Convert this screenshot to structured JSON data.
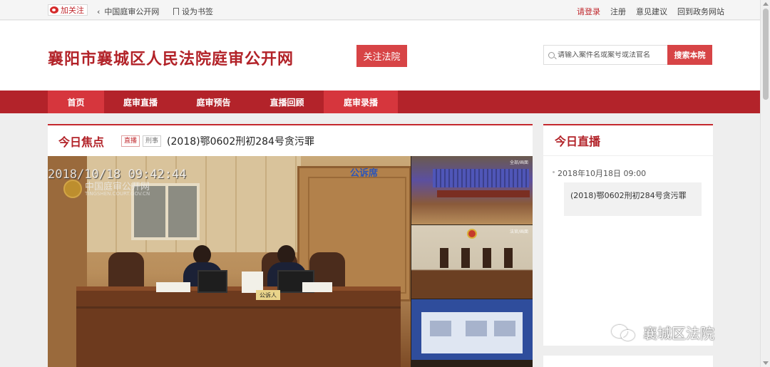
{
  "topbar": {
    "follow": "加关注",
    "back_link": "中国庭审公开网",
    "bookmark": "设为书签",
    "links": [
      "请登录",
      "注册",
      "意见建议",
      "回到政务网站"
    ]
  },
  "header": {
    "site_title": "襄阳市襄城区人民法院庭审公开网",
    "follow_button": "关注法院",
    "search_placeholder": "请输入案件名或案号或法官名",
    "search_button": "搜索本院"
  },
  "nav": {
    "items": [
      "首页",
      "庭审直播",
      "庭审预告",
      "直播回顾",
      "庭审录播"
    ],
    "active_index": 0
  },
  "focus": {
    "title": "今日焦点",
    "tags": [
      "直播",
      "刑事"
    ],
    "case_title": "(2018)鄂0602刑初284号贪污罪"
  },
  "video": {
    "timestamp": "2018/10/18 09:42:44",
    "watermark": "中国庭审公开网",
    "watermark_sub": "TINGSHEN.COURT.GOV.CN",
    "room_sign": "公诉席",
    "nameplate": "公诉人",
    "thumb_label_1": "全部/画面",
    "thumb_label_2": "法官/画面"
  },
  "live": {
    "title": "今日直播",
    "date": "2018年10月18日 09:00",
    "case": "(2018)鄂0602刑初284号贪污罪"
  },
  "overlay": {
    "account": "襄城区法院"
  },
  "colors": {
    "brand_red": "#b3232a",
    "accent_red": "#d74446"
  }
}
